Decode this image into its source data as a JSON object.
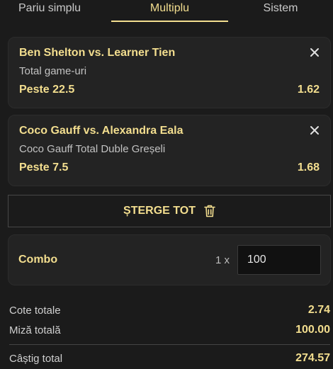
{
  "tabs": [
    {
      "label": "Pariu simplu",
      "active": false
    },
    {
      "label": "Multiplu",
      "active": true
    },
    {
      "label": "Sistem",
      "active": false
    }
  ],
  "selections": [
    {
      "match": "Ben Shelton vs. Learner Tien",
      "market": "Total game-uri",
      "selection": "Peste 22.5",
      "odds": "1.62"
    },
    {
      "match": "Coco Gauff vs. Alexandra Eala",
      "market": "Coco Gauff Total Duble Greșeli",
      "selection": "Peste 7.5",
      "odds": "1.68"
    }
  ],
  "clear_all_label": "ȘTERGE TOT",
  "combo": {
    "title": "Combo",
    "multiplier": "1 x",
    "stake": "100"
  },
  "summary": {
    "total_odds_label": "Cote totale",
    "total_odds": "2.74",
    "total_stake_label": "Miză totală",
    "total_stake": "100.00",
    "total_win_label": "Câștig total",
    "total_win": "274.57"
  },
  "colors": {
    "accent": "#f3de8f",
    "background": "#1b1b1b",
    "card": "#232323"
  },
  "icons": {
    "close": "close-icon",
    "trash": "trash-icon"
  }
}
